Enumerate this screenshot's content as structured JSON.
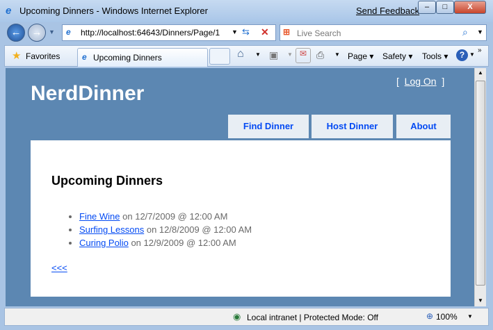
{
  "window": {
    "title": "Upcoming Dinners - Windows Internet Explorer",
    "send_feedback": "Send Feedback",
    "minimize": "–",
    "maximize": "□",
    "close": "X"
  },
  "nav": {
    "url": "http://localhost:64643/Dinners/Page/1",
    "search_placeholder": "Live Search"
  },
  "command_bar": {
    "favorites": "Favorites",
    "tab_title": "Upcoming Dinners",
    "page": "Page",
    "safety": "Safety",
    "tools": "Tools",
    "help": "?"
  },
  "site": {
    "logo": "NerdDinner",
    "logon_open": "[",
    "logon": "Log On",
    "logon_close": "]",
    "tabs": [
      "Find Dinner",
      "Host Dinner",
      "About"
    ]
  },
  "content": {
    "heading": "Upcoming Dinners",
    "dinners": [
      {
        "name": "Fine Wine",
        "date": " on 12/7/2009 @ 12:00 AM"
      },
      {
        "name": "Surfing Lessons",
        "date": " on 12/8/2009 @ 12:00 AM"
      },
      {
        "name": "Curing Polio",
        "date": " on 12/9/2009 @ 12:00 AM"
      }
    ],
    "prev_link": "<<<"
  },
  "status": {
    "zone": "Local intranet | Protected Mode: Off",
    "zoom": "100%"
  }
}
